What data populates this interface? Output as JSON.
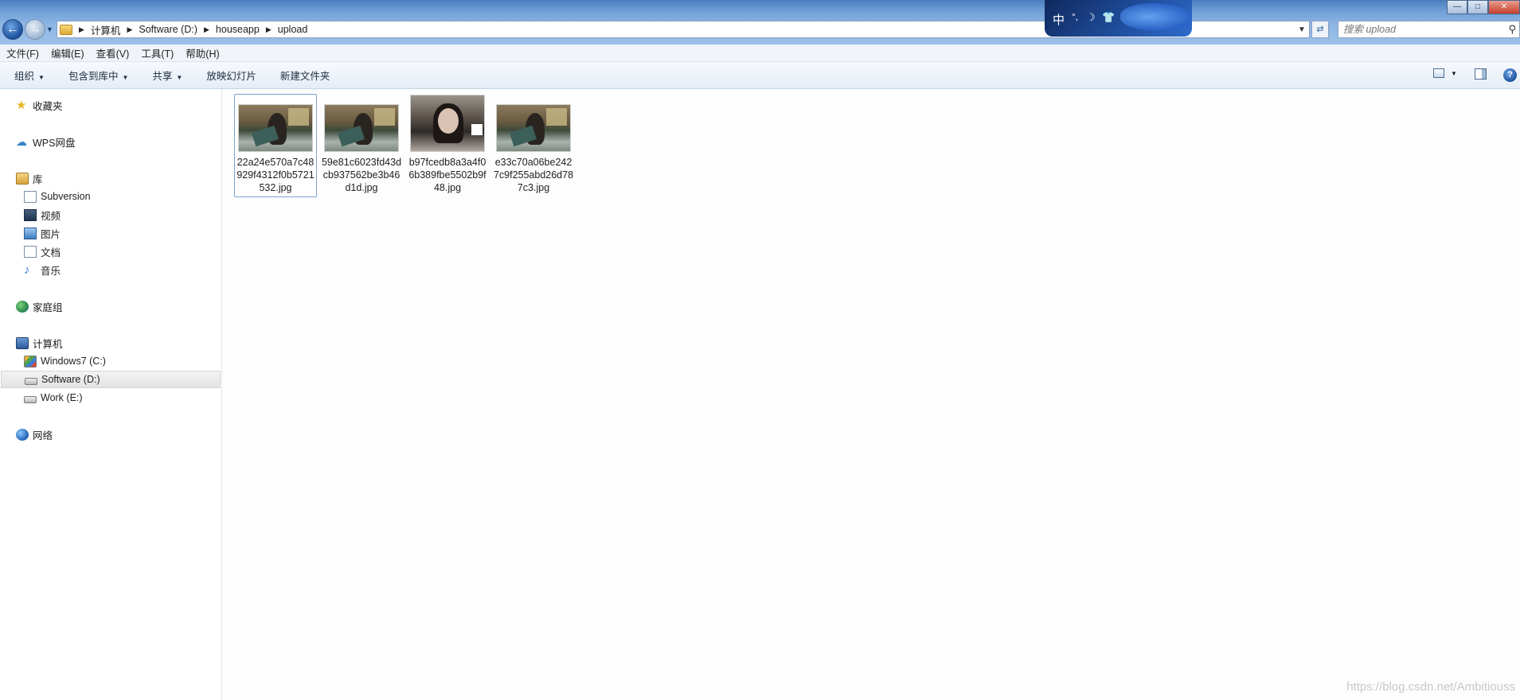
{
  "addressbar": {
    "breadcrumbs": [
      "计算机",
      "Software (D:)",
      "houseapp",
      "upload"
    ],
    "search_placeholder": "搜索 upload"
  },
  "ime_toolbar": {
    "mode_label": "中",
    "items": [
      "°,",
      "☽",
      "👕"
    ]
  },
  "menubar": {
    "items": [
      "文件(F)",
      "编辑(E)",
      "查看(V)",
      "工具(T)",
      "帮助(H)"
    ]
  },
  "toolbar": {
    "organize": "组织",
    "include_in_library": "包含到库中",
    "share": "共享",
    "slideshow": "放映幻灯片",
    "new_folder": "新建文件夹"
  },
  "navpane": {
    "favorites": "收藏夹",
    "wps_cloud": "WPS网盘",
    "libraries": "库",
    "library_items": [
      "Subversion",
      "视频",
      "图片",
      "文档",
      "音乐"
    ],
    "homegroup": "家庭组",
    "computer": "计算机",
    "drives": [
      "Windows7 (C:)",
      "Software (D:)",
      "Work (E:)"
    ],
    "selected_drive": "Software (D:)",
    "network": "网络"
  },
  "files": [
    {
      "name": "22a24e570a7c48929f4312f0b5721532.jpg",
      "selected": true
    },
    {
      "name": "59e81c6023fd43dcb937562be3b46d1d.jpg",
      "selected": false
    },
    {
      "name": "b97fcedb8a3a4f06b389fbe5502b9f48.jpg",
      "selected": false
    },
    {
      "name": "e33c70a06be2427c9f255abd26d787c3.jpg",
      "selected": false
    }
  ],
  "watermark": "https://blog.csdn.net/Ambitiouss"
}
